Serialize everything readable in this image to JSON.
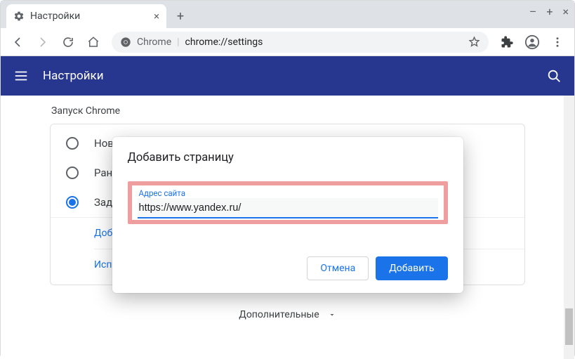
{
  "browser": {
    "tab_title": "Настройки",
    "omnibox_prefix": "Chrome",
    "omnibox_url": "chrome://settings"
  },
  "header": {
    "title": "Настройки"
  },
  "startup": {
    "section_title": "Запуск Chrome",
    "options": [
      {
        "label": "Новая вкладка",
        "selected": false
      },
      {
        "label": "Ранее открытые вкладки",
        "selected": false
      },
      {
        "label": "Заданные страницы",
        "selected": true
      }
    ],
    "sublinks": [
      "Добавить страницу",
      "Использовать текущие страницы"
    ]
  },
  "advanced_label": "Дополнительные",
  "dialog": {
    "title": "Добавить страницу",
    "field_label": "Адрес сайта",
    "field_value": "https://www.yandex.ru/",
    "cancel": "Отмена",
    "confirm": "Добавить"
  }
}
